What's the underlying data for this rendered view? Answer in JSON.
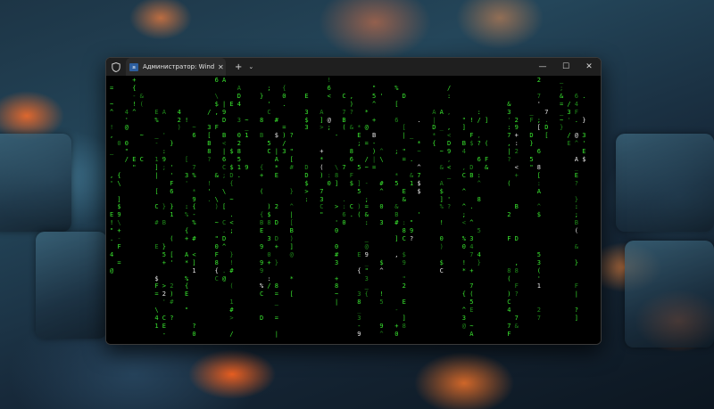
{
  "window": {
    "tab_title": "Администратор: Windows PowerShell",
    "new_tab_symbol": "+",
    "dropdown_symbol": "⌄",
    "minimize_symbol": "—",
    "maximize_symbol": "☐",
    "close_symbol": "✕",
    "tab_close_symbol": "✕",
    "app_icon_text": "≥"
  },
  "colors": {
    "matrix_green": "#39e62f",
    "matrix_dim": "#1f8a1a",
    "terminal_bg": "#000000",
    "titlebar_bg": "#1f1f1f"
  },
  "matrix": {
    "charset": "0123456789!@#$%^&*()[]{}<>?/\\|+=-~_;:'\".,ABCDEF",
    "columns": 64,
    "rows": 33
  }
}
